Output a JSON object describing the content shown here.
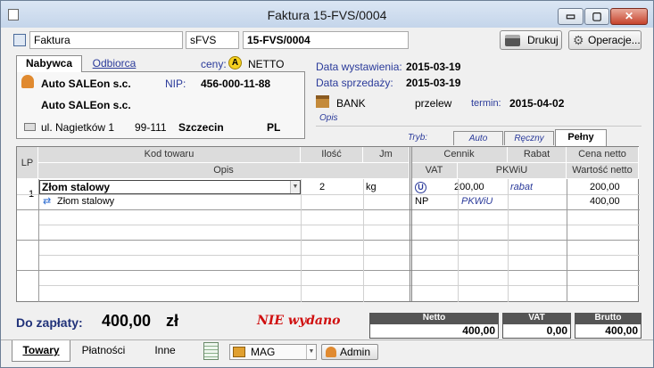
{
  "window": {
    "title": "Faktura 15-FVS/0004",
    "min": "▭",
    "max": "▢",
    "close": "✕"
  },
  "toolbar": {
    "doc_type": "Faktura",
    "series": "sFVS",
    "number": "15-FVS/0004",
    "print_label": "Drukuj",
    "ops_label": "Operacje..."
  },
  "party": {
    "tab_buyer": "Nabywca",
    "tab_recipient": "Odbiorca",
    "prices_label": "ceny:",
    "prices_badge": "A",
    "prices_value": "NETTO",
    "name": "Auto SALEon s.c.",
    "nip_label": "NIP:",
    "nip": "456-000-11-88",
    "name2": "Auto SALEon s.c.",
    "street": "ul. Nagietków 1",
    "zip": "99-111",
    "city": "Szczecin",
    "country": "PL"
  },
  "dates": {
    "issue_label": "Data wystawienia:",
    "issue": "2015-03-19",
    "sale_label": "Data sprzedaży:",
    "sale": "2015-03-19"
  },
  "payment": {
    "bank": "BANK",
    "method": "przelew",
    "due_label": "termin:",
    "due": "2015-04-02",
    "opis_placeholder": "Opis"
  },
  "mode": {
    "label": "Tryb:",
    "tabs": [
      "Auto",
      "Ręczny",
      "Pełny"
    ]
  },
  "grid": {
    "headers": {
      "lp": "LP",
      "kod": "Kod towaru",
      "opis": "Opis",
      "ilosc": "Ilość",
      "jm": "Jm",
      "cennik": "Cennik",
      "rabat": "Rabat",
      "vat": "VAT",
      "pkwiu": "PKWiU",
      "cena_netto": "Cena netto",
      "wartosc_netto": "Wartość netto"
    },
    "row": {
      "lp": "1",
      "kod": "Złom stalowy",
      "ilosc": "2",
      "jm": "kg",
      "price_badge": "U",
      "cennik": "200,00",
      "rabat": "rabat",
      "cena_netto": "200,00",
      "opis": "Złom stalowy",
      "vat": "NP",
      "pkwiu": "PKWiU",
      "wartosc_netto": "400,00"
    }
  },
  "totals": {
    "due_label": "Do zapłaty:",
    "due_value": "400,00",
    "currency": "zł",
    "status": "NIE wydano",
    "netto_label": "Netto",
    "netto": "400,00",
    "vat_label": "VAT",
    "vat": "0,00",
    "brutto_label": "Brutto",
    "brutto": "400,00"
  },
  "bottom": {
    "tabs": [
      "Towary",
      "Płatności",
      "Inne"
    ],
    "warehouse": "MAG",
    "user": "Admin"
  },
  "colors": {
    "accent_blue": "#2a3a9a",
    "status_red": "#d01010",
    "header_gray": "#dcdcdc"
  }
}
